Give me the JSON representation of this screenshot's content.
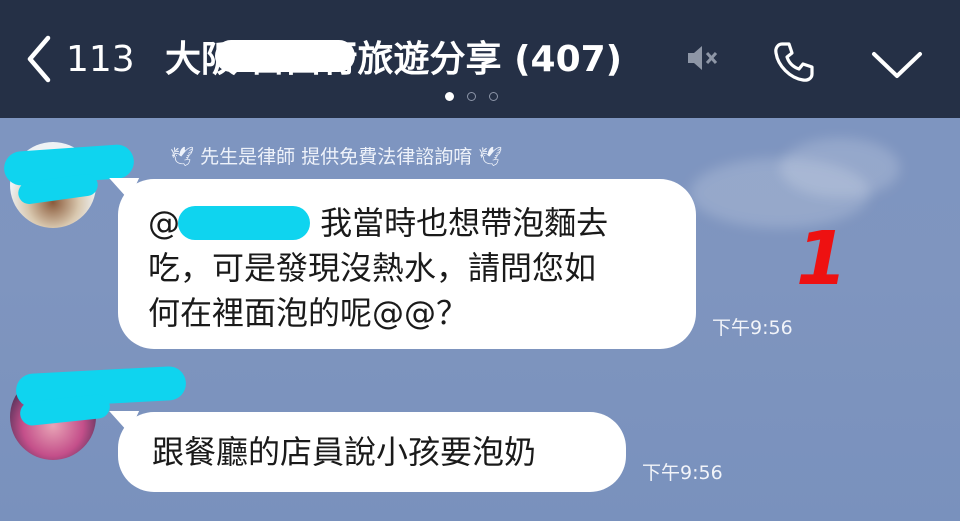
{
  "header": {
    "back_count": "113",
    "title": "大阪 自由行旅遊分享 (407)",
    "page_dots": [
      true,
      false,
      false
    ]
  },
  "messages": [
    {
      "sender": "先生是律師 提供免費法律諮詢唷",
      "mention": "@",
      "text_line1": "我當時也想帶泡麵去",
      "text_line2": "吃，可是發現沒熱水，請問您如",
      "text_line3": "何在裡面泡的呢@@？",
      "time": "下午9:56"
    },
    {
      "text": "跟餐廳的店員說小孩要泡奶",
      "time": "下午9:56"
    }
  ],
  "annotation": "1",
  "colors": {
    "header_bg": "#253046",
    "chat_bg": "#7f94bd",
    "bubble": "#ffffff",
    "redaction": "#0fd4ef",
    "annotation": "#ee1111"
  }
}
